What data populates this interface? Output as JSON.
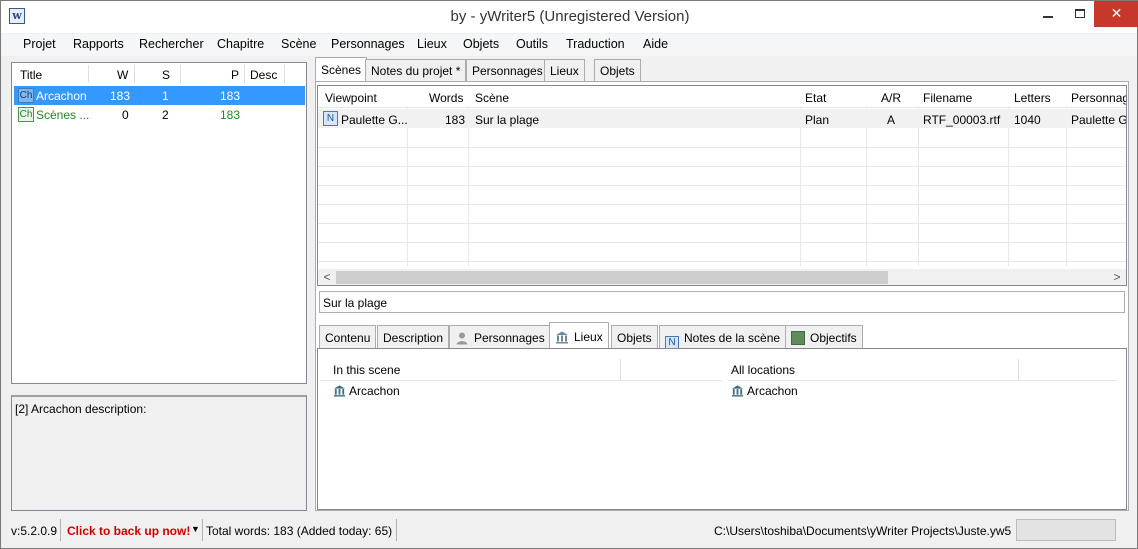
{
  "window": {
    "title": "by  - yWriter5 (Unregistered Version)",
    "app_icon": "w",
    "minimize_label": "",
    "maximize_label": "",
    "close_label": "✕"
  },
  "menu": [
    "Projet",
    "Rapports",
    "Rechercher",
    "Chapitre",
    "Scène",
    "Personnages",
    "Lieux",
    "Objets",
    "Outils",
    "Traduction",
    "Aide"
  ],
  "chapters": {
    "headers": {
      "title": "Title",
      "w": "W",
      "s": "S",
      "p": "P",
      "desc": "Desc"
    },
    "icon_label": "Ch",
    "rows": [
      {
        "title": "Arcachon",
        "w": "183",
        "s": "1",
        "p": "183",
        "selected": true
      },
      {
        "title": "Scènes ...",
        "w": "0",
        "s": "2",
        "p": "183",
        "selected": false
      }
    ],
    "description": "[2] Arcachon description:"
  },
  "top_tabs": [
    "Scènes",
    "Notes du projet *",
    "Personnages",
    "Lieux",
    "Objets"
  ],
  "scene_grid": {
    "headers": {
      "viewpoint": "Viewpoint",
      "words": "Words",
      "scene": "Scène",
      "etat": "Etat",
      "ar": "A/R",
      "filename": "Filename",
      "letters": "Letters",
      "personnages": "Personnag"
    },
    "icon_label": "N",
    "rows": [
      {
        "viewpoint": "Paulette G...",
        "words": "183",
        "scene": "Sur la plage",
        "etat": "Plan",
        "ar": "A",
        "filename": "RTF_00003.rtf",
        "letters": "1040",
        "personnages": "Paulette G"
      }
    ],
    "scroll_left": "<",
    "scroll_right": ">"
  },
  "scene_title": "Sur la plage",
  "bottom_tabs": [
    "Contenu",
    "Description",
    "Personnages",
    "Lieux",
    "Objets",
    "Notes de la scène",
    "Objectifs"
  ],
  "locations": {
    "in_scene_header": "In this scene",
    "all_header": "All locations",
    "in_scene": [
      "Arcachon"
    ],
    "all": [
      "Arcachon"
    ]
  },
  "status": {
    "version": "v:5.2.0.9",
    "backup": "Click to back up now!",
    "dropdown": "▼",
    "total_words": "Total words: 183 (Added today: 65)",
    "path": "C:\\Users\\toshiba\\Documents\\yWriter Projects\\Juste.yw5"
  },
  "colors": {
    "selection": "#3399ff",
    "backup_text": "#d10000",
    "close_button": "#c7382c",
    "green_row": "#1f8a1f"
  }
}
